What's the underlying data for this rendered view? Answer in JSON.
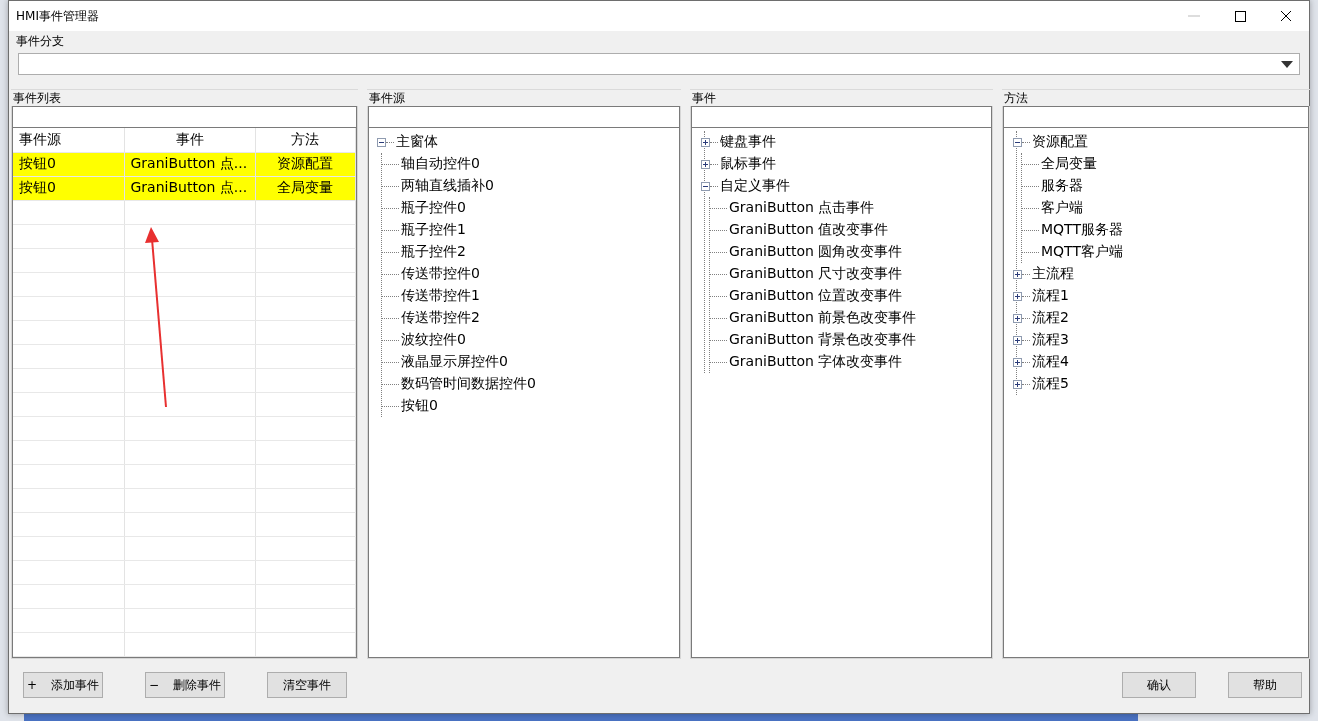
{
  "window": {
    "title": "HMI事件管理器"
  },
  "branch": {
    "label": "事件分支"
  },
  "event_list": {
    "title": "事件列表",
    "columns": [
      "事件源",
      "事件",
      "方法"
    ],
    "rows": [
      {
        "cells": [
          "按钮0",
          "GraniButton 点...",
          "资源配置"
        ],
        "selected": true
      },
      {
        "cells": [
          "按钮0",
          "GraniButton 点...",
          "全局变量"
        ],
        "selected": true
      }
    ]
  },
  "event_source": {
    "title": "事件源",
    "tree": [
      {
        "label": "主窗体",
        "expanded": true,
        "children": [
          {
            "label": "轴自动控件0"
          },
          {
            "label": "两轴直线插补0"
          },
          {
            "label": "瓶子控件0"
          },
          {
            "label": "瓶子控件1"
          },
          {
            "label": "瓶子控件2"
          },
          {
            "label": "传送带控件0"
          },
          {
            "label": "传送带控件1"
          },
          {
            "label": "传送带控件2"
          },
          {
            "label": "波纹控件0"
          },
          {
            "label": "液晶显示屏控件0"
          },
          {
            "label": "数码管时间数据控件0"
          },
          {
            "label": "按钮0"
          }
        ]
      }
    ]
  },
  "events": {
    "title": "事件",
    "tree": [
      {
        "label": "键盘事件",
        "expanded": false
      },
      {
        "label": "鼠标事件",
        "expanded": false
      },
      {
        "label": "自定义事件",
        "expanded": true,
        "children": [
          {
            "label": "GraniButton 点击事件"
          },
          {
            "label": "GraniButton 值改变事件"
          },
          {
            "label": "GraniButton 圆角改变事件"
          },
          {
            "label": "GraniButton 尺寸改变事件"
          },
          {
            "label": "GraniButton 位置改变事件"
          },
          {
            "label": "GraniButton 前景色改变事件"
          },
          {
            "label": "GraniButton 背景色改变事件"
          },
          {
            "label": "GraniButton 字体改变事件"
          }
        ]
      }
    ]
  },
  "methods": {
    "title": "方法",
    "tree": [
      {
        "label": "资源配置",
        "expanded": true,
        "children": [
          {
            "label": "全局变量"
          },
          {
            "label": "服务器"
          },
          {
            "label": "客户端"
          },
          {
            "label": "MQTT服务器"
          },
          {
            "label": "MQTT客户端"
          }
        ]
      },
      {
        "label": "主流程",
        "expanded": false
      },
      {
        "label": "流程1",
        "expanded": false
      },
      {
        "label": "流程2",
        "expanded": false
      },
      {
        "label": "流程3",
        "expanded": false
      },
      {
        "label": "流程4",
        "expanded": false
      },
      {
        "label": "流程5",
        "expanded": false
      }
    ]
  },
  "buttons_left": [
    {
      "icon": "+",
      "label": "添加事件"
    },
    {
      "icon": "−",
      "label": "删除事件"
    },
    {
      "label": "清空事件"
    }
  ],
  "buttons_right": [
    {
      "label": "确认"
    },
    {
      "label": "帮助"
    }
  ]
}
